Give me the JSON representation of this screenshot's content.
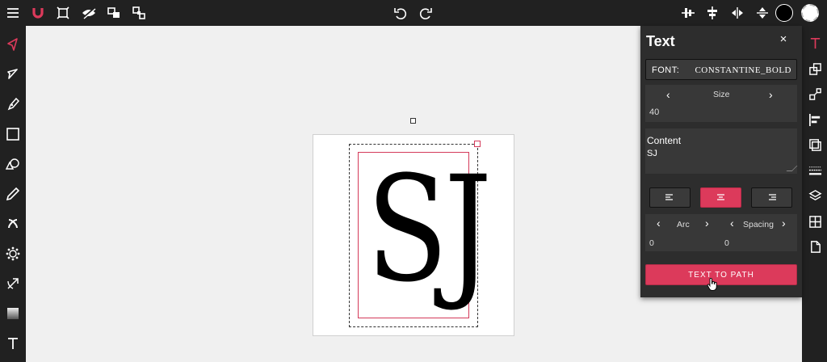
{
  "panel": {
    "title": "Text",
    "close": "×",
    "font_label": "FONT:",
    "font_value": "CONSTANTINE_BOLD",
    "size_label": "Size",
    "size_value": "40",
    "content_label": "Content",
    "content_value": "SJ",
    "arc_label": "Arc",
    "arc_value": "0",
    "spacing_label": "Spacing",
    "spacing_value": "0",
    "text_to_path": "TEXT TO PATH",
    "alignment_selected": "center"
  },
  "canvas": {
    "text": "SJ"
  },
  "colors": {
    "accent": "#dc3a5b",
    "toolbar_bg": "#212121",
    "panel_bg": "#2d2d2d",
    "canvas_bg": "#f0f0f0"
  },
  "icons": {
    "top_left": [
      "menu-icon",
      "magnet-icon",
      "fit-frame-icon",
      "hide-icon",
      "group-icon",
      "ungroup-icon"
    ],
    "top_center": [
      "undo-icon",
      "redo-icon"
    ],
    "top_right": [
      "align-center-vertical-icon",
      "align-center-horizontal-icon",
      "flip-horizontal-icon",
      "flip-vertical-icon",
      "fill-color-swatch",
      "stroke-color-swatch"
    ],
    "left": [
      "pointer-icon",
      "direct-select-icon",
      "pen-icon",
      "rectangle-icon",
      "shape-icon",
      "pencil-icon",
      "brush-icon",
      "pattern-icon",
      "gradient-arrow-icon",
      "gradient-icon",
      "text-icon"
    ],
    "right": [
      "text-icon",
      "transform-icon",
      "resize-icon",
      "align-left-icon",
      "boolean-icon",
      "stroke-style-icon",
      "layers-icon",
      "grid-icon",
      "document-icon"
    ]
  }
}
